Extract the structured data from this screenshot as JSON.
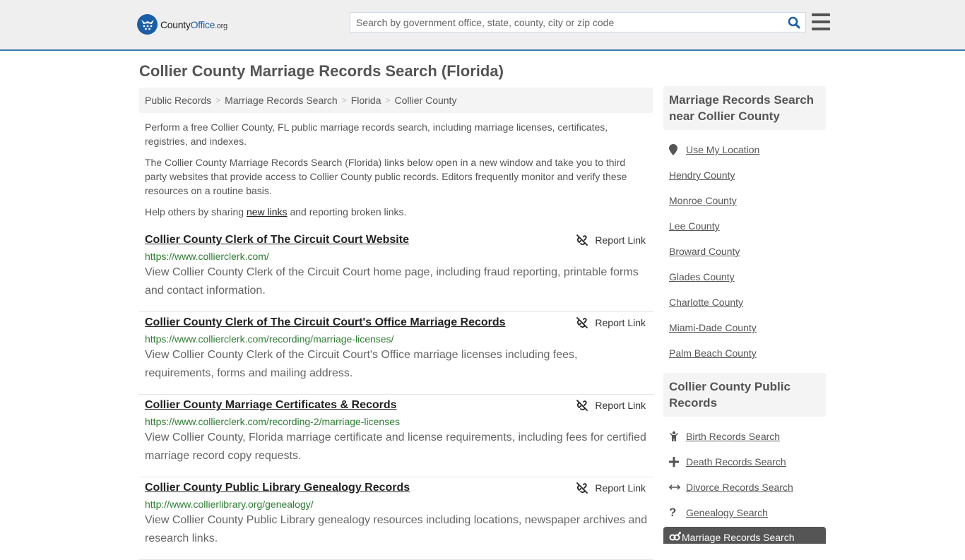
{
  "header": {
    "logo": {
      "part1": "County",
      "part2": "Office",
      "part3": ".org"
    },
    "search_placeholder": "Search by government office, state, county, city or zip code",
    "search_value": ""
  },
  "page": {
    "title": "Collier County Marriage Records Search (Florida)"
  },
  "breadcrumb": [
    {
      "label": "Public Records"
    },
    {
      "label": "Marriage Records Search"
    },
    {
      "label": "Florida"
    },
    {
      "label": "Collier County"
    }
  ],
  "intro": {
    "p1": "Perform a free Collier County, FL public marriage records search, including marriage licenses, certificates, registries, and indexes.",
    "p2": "The Collier County Marriage Records Search (Florida) links below open in a new window and take you to third party websites that provide access to Collier County public records. Editors frequently monitor and verify these resources on a routine basis.",
    "p3_before": "Help others by sharing ",
    "p3_link": "new links",
    "p3_after": " and reporting broken links."
  },
  "results": [
    {
      "title": "Collier County Clerk of The Circuit Court Website",
      "url": "https://www.collierclerk.com/",
      "description": "View Collier County Clerk of the Circuit Court home page, including fraud reporting, printable forms and contact information.",
      "report_label": "Report Link"
    },
    {
      "title": "Collier County Clerk of The Circuit Court's Office Marriage Records",
      "url": "https://www.collierclerk.com/recording/marriage-licenses/",
      "description": "View Collier County Clerk of the Circuit Court's Office marriage licenses including fees, requirements, forms and mailing address.",
      "report_label": "Report Link"
    },
    {
      "title": "Collier County Marriage Certificates & Records",
      "url": "https://www.collierclerk.com/recording-2/marriage-licenses",
      "description": "View Collier County, Florida marriage certificate and license requirements, including fees for certified marriage record copy requests.",
      "report_label": "Report Link"
    },
    {
      "title": "Collier County Public Library Genealogy Records",
      "url": "http://www.collierlibrary.org/genealogy/",
      "description": "View Collier County Public Library genealogy resources including locations, newspaper archives and research links.",
      "report_label": "Report Link"
    }
  ],
  "sidebar": {
    "nearby_heading": "Marriage Records Search near Collier County",
    "use_location": "Use My Location",
    "nearby": [
      "Hendry County",
      "Monroe County",
      "Lee County",
      "Broward County",
      "Glades County",
      "Charlotte County",
      "Miami-Dade County",
      "Palm Beach County"
    ],
    "public_heading": "Collier County Public Records",
    "public_records": [
      {
        "label": "Birth Records Search",
        "icon": "child-icon"
      },
      {
        "label": "Death Records Search",
        "icon": "cross-icon"
      },
      {
        "label": "Divorce Records Search",
        "icon": "arrows-horizontal-icon"
      },
      {
        "label": "Genealogy Search",
        "icon": "question-icon"
      }
    ],
    "active_item": {
      "label": "Marriage Records Search",
      "icon": "marriage-icon"
    }
  },
  "colors": {
    "brand_blue": "#1a5ea6",
    "header_border": "#3b7bb0",
    "url_green": "#2e7d32",
    "active_bg": "#555555"
  }
}
